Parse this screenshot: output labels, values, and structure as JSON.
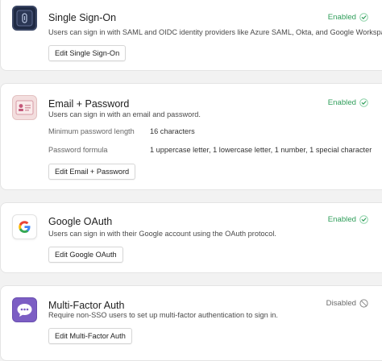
{
  "colors": {
    "enabled": "#2f9e5a",
    "disabled": "#6a6a6a",
    "sso_icon_bg": "#1f2a44",
    "email_icon_bg": "#f3dede",
    "mfa_icon_bg": "#7c5ec4"
  },
  "providers": [
    {
      "title": "Single Sign-On",
      "description": "Users can sign in with SAML and OIDC identity providers like Azure SAML, Okta, and Google Workspace",
      "status": "Enabled",
      "status_icon": "check-circle-icon",
      "icon": "chip-icon",
      "button": "Edit Single Sign-On"
    },
    {
      "title": "Email + Password",
      "description": "Users can sign in with an email and password.",
      "status": "Enabled",
      "status_icon": "check-circle-icon",
      "icon": "id-card-icon",
      "details": [
        {
          "label": "Minimum password length",
          "value": "16 characters"
        },
        {
          "label": "Password formula",
          "value": "1 uppercase letter, 1 lowercase letter, 1 number, 1 special character"
        }
      ],
      "button": "Edit Email + Password"
    },
    {
      "title": "Google OAuth",
      "description": "Users can sign in with their Google account using the OAuth protocol.",
      "status": "Enabled",
      "status_icon": "check-circle-icon",
      "icon": "google-logo-icon",
      "button": "Edit Google OAuth"
    },
    {
      "title": "Multi-Factor Auth",
      "description": "Require non-SSO users to set up multi-factor authentication to sign in.",
      "status": "Disabled",
      "status_icon": "disabled-circle-icon",
      "icon": "chat-dots-icon",
      "button": "Edit Multi-Factor Auth"
    }
  ]
}
